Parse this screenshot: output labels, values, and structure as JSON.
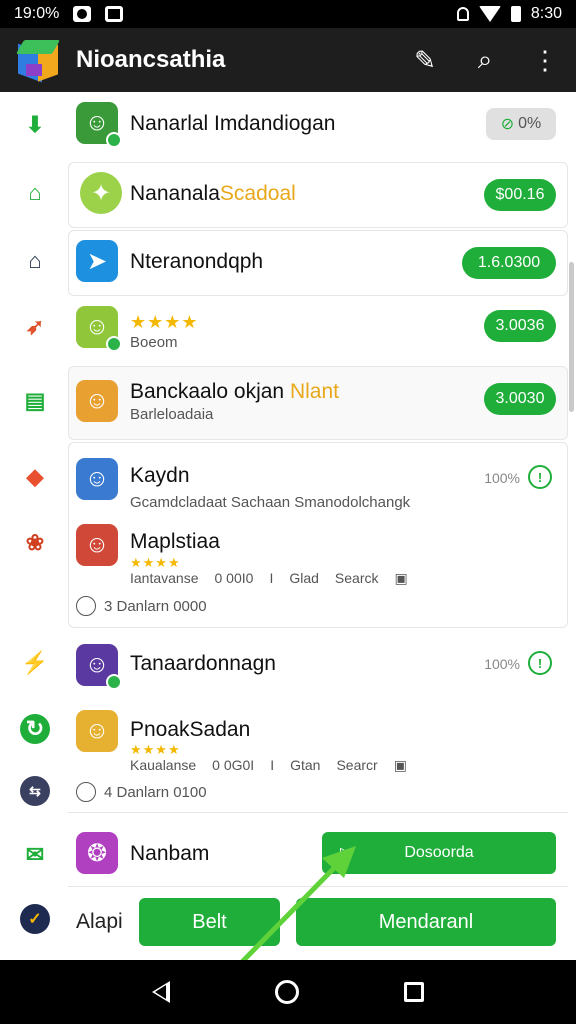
{
  "status": {
    "left_time": "19:0%",
    "right_time": "8:30"
  },
  "appbar": {
    "title": "Nioancsathia",
    "icons": [
      "pen-icon",
      "search-icon",
      "more-vert-icon"
    ]
  },
  "rows": [
    {
      "title": "Nanarlal Imdandiogan",
      "action": "0%",
      "action_style": "gray"
    },
    {
      "title": "Nananala",
      "title_accent": "Scadoal",
      "action": "$00.16"
    },
    {
      "title": "Nteranondqph",
      "action": "1.6.0300"
    },
    {
      "stars": "★★★★",
      "sub": "Boeom",
      "action": "3.0036"
    },
    {
      "title": "Banckaalo okjan",
      "title_accent": "Nlant",
      "sub": "Barleloadaia",
      "action": "3.0030"
    },
    {
      "title": "Kaydn",
      "pct": "100%",
      "sub": "Gcamdcladaat Sachaan Smanodolchangk"
    },
    {
      "title": "Maplstiaa",
      "stars": "★★★★",
      "meta": [
        "Iantavanse",
        "0 00I0",
        "I",
        "Glad",
        "Searck"
      ],
      "foot": "3 Danlarn 0000"
    },
    {
      "title": "Tanaardonnagn",
      "pct": "100%"
    },
    {
      "title": "PnoakSadan",
      "stars": "★★★★",
      "meta": [
        "Kaualanse",
        "0 0G0I",
        "I",
        "Gtan",
        "Searcr"
      ],
      "foot": "4 Danlarn 0100"
    },
    {
      "title": "Nanbam",
      "action": "Dosoorda"
    }
  ],
  "bottom": {
    "label": "Alapi",
    "btn1": "Belt",
    "btn2": "Mendaranl"
  },
  "colors": {
    "green": "#1fae3a",
    "appbar": "#1e1e1e"
  }
}
